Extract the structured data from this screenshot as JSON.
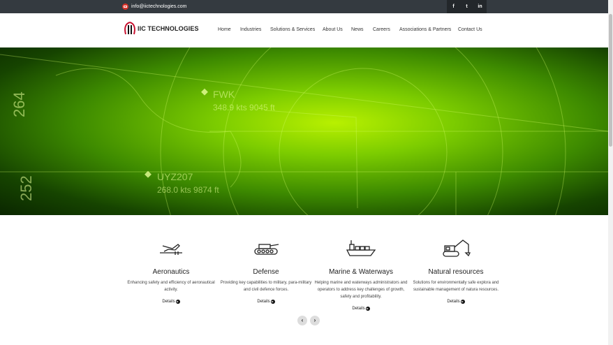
{
  "topbar": {
    "email": "info@iictechnologies.com",
    "social": [
      "f",
      "t",
      "in"
    ]
  },
  "logo": {
    "text": "IIC TECHNOLOGIES"
  },
  "nav": {
    "items": [
      "Home",
      "Industries",
      "Solutions & Services",
      "About Us",
      "News",
      "Careers",
      "Associations & Partners",
      "Contact Us"
    ]
  },
  "hero": {
    "labels": [
      "264",
      "252",
      "FWK",
      "348.9 kts 9045 ft",
      "UYZ207",
      "268.0 kts 9874 ft"
    ]
  },
  "cards": [
    {
      "title": "Aeronautics",
      "desc": "Enhancing safety and efficiency of aeronautical activity.",
      "link": "Details"
    },
    {
      "title": "Defense",
      "desc": "Providing key capabilities to military, para-military and civil defence forces.",
      "link": "Details"
    },
    {
      "title": "Marine & Waterways",
      "desc": "Helping marine and waterways administrators and operators to address key challenges of growth, safety and profitability.",
      "link": "Details"
    },
    {
      "title": "Natural resources",
      "desc": "Solutions for environmentally safe explora and sustainable management of natura resources.",
      "link": "Details"
    }
  ],
  "carousel": {
    "prev": "‹",
    "next": "›"
  },
  "colors": {
    "topbar": "#343a40",
    "accent_red": "#d9342b",
    "hero_green": "#7ccc00"
  }
}
